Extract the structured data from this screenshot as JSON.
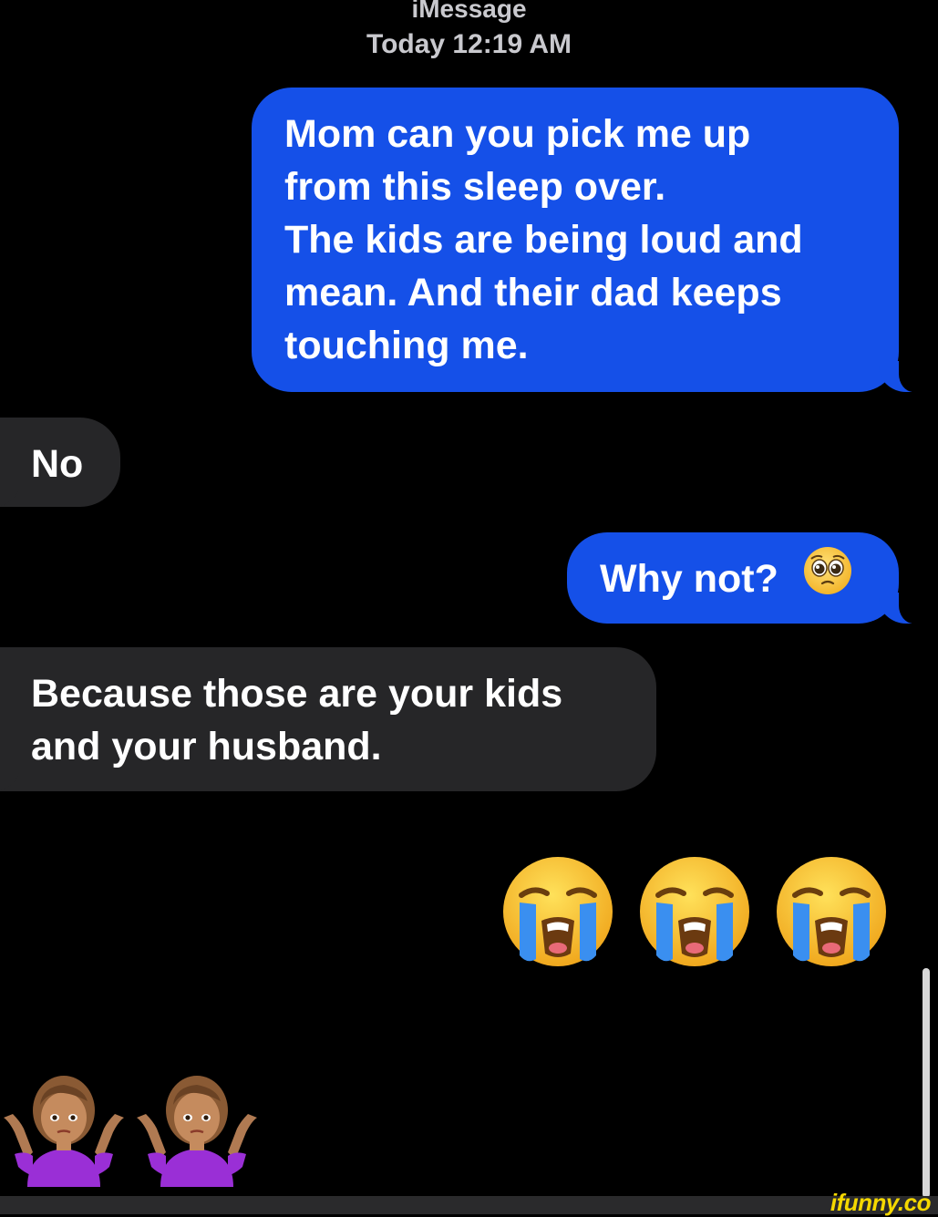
{
  "header": {
    "service": "iMessage",
    "timestamp": "Today 12:19 AM"
  },
  "messages": [
    {
      "direction": "outgoing",
      "lines": [
        "Mom can you pick me up",
        "from this sleep over.",
        "The kids are being loud and",
        "mean. And their dad keeps",
        "touching me."
      ]
    },
    {
      "direction": "incoming",
      "text": "No"
    },
    {
      "direction": "outgoing",
      "text": "Why not?",
      "emoji": "pleading-face-icon"
    },
    {
      "direction": "incoming",
      "lines": [
        "Because those are your kids",
        "and your husband."
      ]
    },
    {
      "direction": "outgoing",
      "emoji": [
        "loudly-crying-face-icon",
        "loudly-crying-face-icon",
        "loudly-crying-face-icon"
      ]
    },
    {
      "direction": "incoming",
      "emoji": [
        "person-shrugging-icon",
        "person-shrugging-icon"
      ]
    }
  ],
  "watermark": "ifunny.co",
  "colors": {
    "background": "#000000",
    "outgoing_bubble": "#1550e8",
    "incoming_bubble": "#262628",
    "header_text": "#c9c9ce",
    "watermark": "#f5d800"
  }
}
